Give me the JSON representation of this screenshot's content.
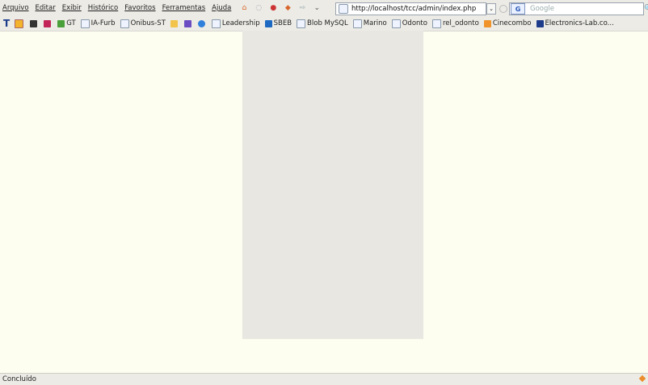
{
  "menu": [
    "Arquivo",
    "Editar",
    "Exibir",
    "Histórico",
    "Favoritos",
    "Ferramentas",
    "Ajuda"
  ],
  "address": {
    "url": "http://localhost/tcc/admin/index.php"
  },
  "search": {
    "engine": "G",
    "placeholder": "Google"
  },
  "bookmarks": [
    {
      "label": "GT"
    },
    {
      "label": "IA-Furb"
    },
    {
      "label": "Onibus-ST"
    },
    {
      "label": "Leadership"
    },
    {
      "label": "SBEB"
    },
    {
      "label": "Blob MySQL"
    },
    {
      "label": "Marino"
    },
    {
      "label": "Odonto"
    },
    {
      "label": "rel_odonto"
    },
    {
      "label": "Cinecombo"
    },
    {
      "label": "Electronics-Lab.co..."
    }
  ],
  "bookmarks_first": "T",
  "status": {
    "text": "Concluído"
  },
  "colors": {
    "page_bg": "#fdfdf0",
    "panel_bg": "#e8e7e1",
    "chrome_bg": "#ecebe6"
  }
}
